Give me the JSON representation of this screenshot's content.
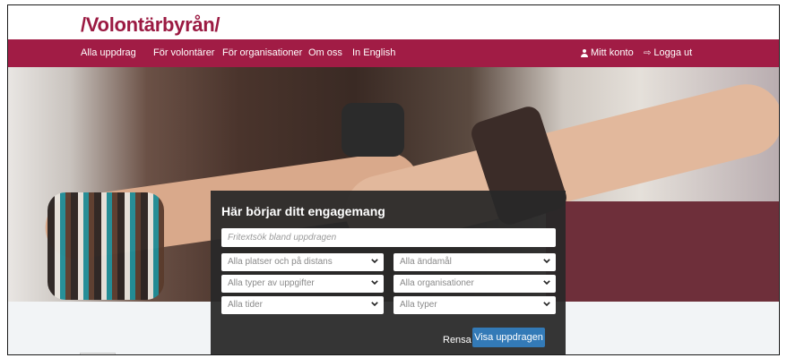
{
  "site": {
    "logo": "/Volontärbyrån/"
  },
  "nav": {
    "items": [
      {
        "label": "Alla uppdrag"
      },
      {
        "label": "För volontärer"
      },
      {
        "label": "För organisationer"
      },
      {
        "label": "Om oss"
      },
      {
        "label": "In English"
      }
    ],
    "account": {
      "label": "Mitt konto",
      "icon": "user-icon"
    },
    "logout": {
      "label": "Logga ut",
      "icon": "sign-out-icon"
    }
  },
  "search": {
    "title": "Här börjar ditt engagemang",
    "input_placeholder": "Fritextsök bland uppdragen",
    "filters": {
      "places": "Alla platser och på distans",
      "purposes": "Alla ändamål",
      "task_types": "Alla typer av uppgifter",
      "organisations": "Alla organisationer",
      "times": "Alla tider",
      "types": "Alla typer"
    },
    "clear_label": "Rensa",
    "submit_label": "Visa uppdragen"
  },
  "colors": {
    "brand": "#a11c45",
    "logo": "#9b1a42",
    "button": "#337ab7"
  }
}
